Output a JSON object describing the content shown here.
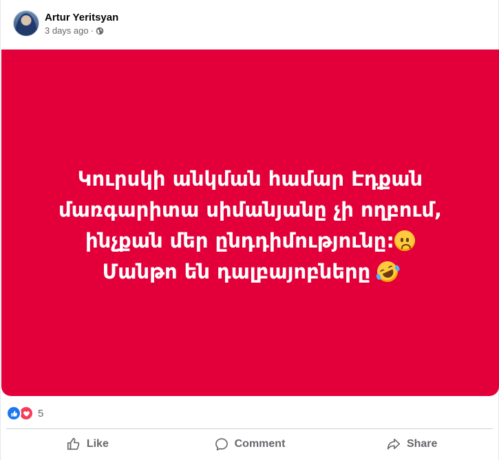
{
  "post": {
    "author": "Artur Yeritsyan",
    "time": "3 days ago",
    "separator": "·",
    "privacy_icon": "globe-icon",
    "background_color": "#e3003a",
    "text_lines": [
      "Կուրսկի անկման համար Էդքան",
      "մառգարիտա սիմանյանը չի ողբում,",
      "ինչքան մեր ընդդիմությունը:",
      "Մանթո են դալբայոբները"
    ],
    "emojis": [
      "worried-face-emoji",
      "rolling-on-floor-laughing-emoji"
    ]
  },
  "reactions": {
    "icons": [
      "like-icon",
      "love-icon"
    ],
    "count": "5"
  },
  "actions": {
    "like_label": "Like",
    "comment_label": "Comment",
    "share_label": "Share"
  },
  "colors": {
    "like_blue": "#1877f2",
    "love_red": "#f33e58",
    "secondary_text": "#65676b"
  }
}
